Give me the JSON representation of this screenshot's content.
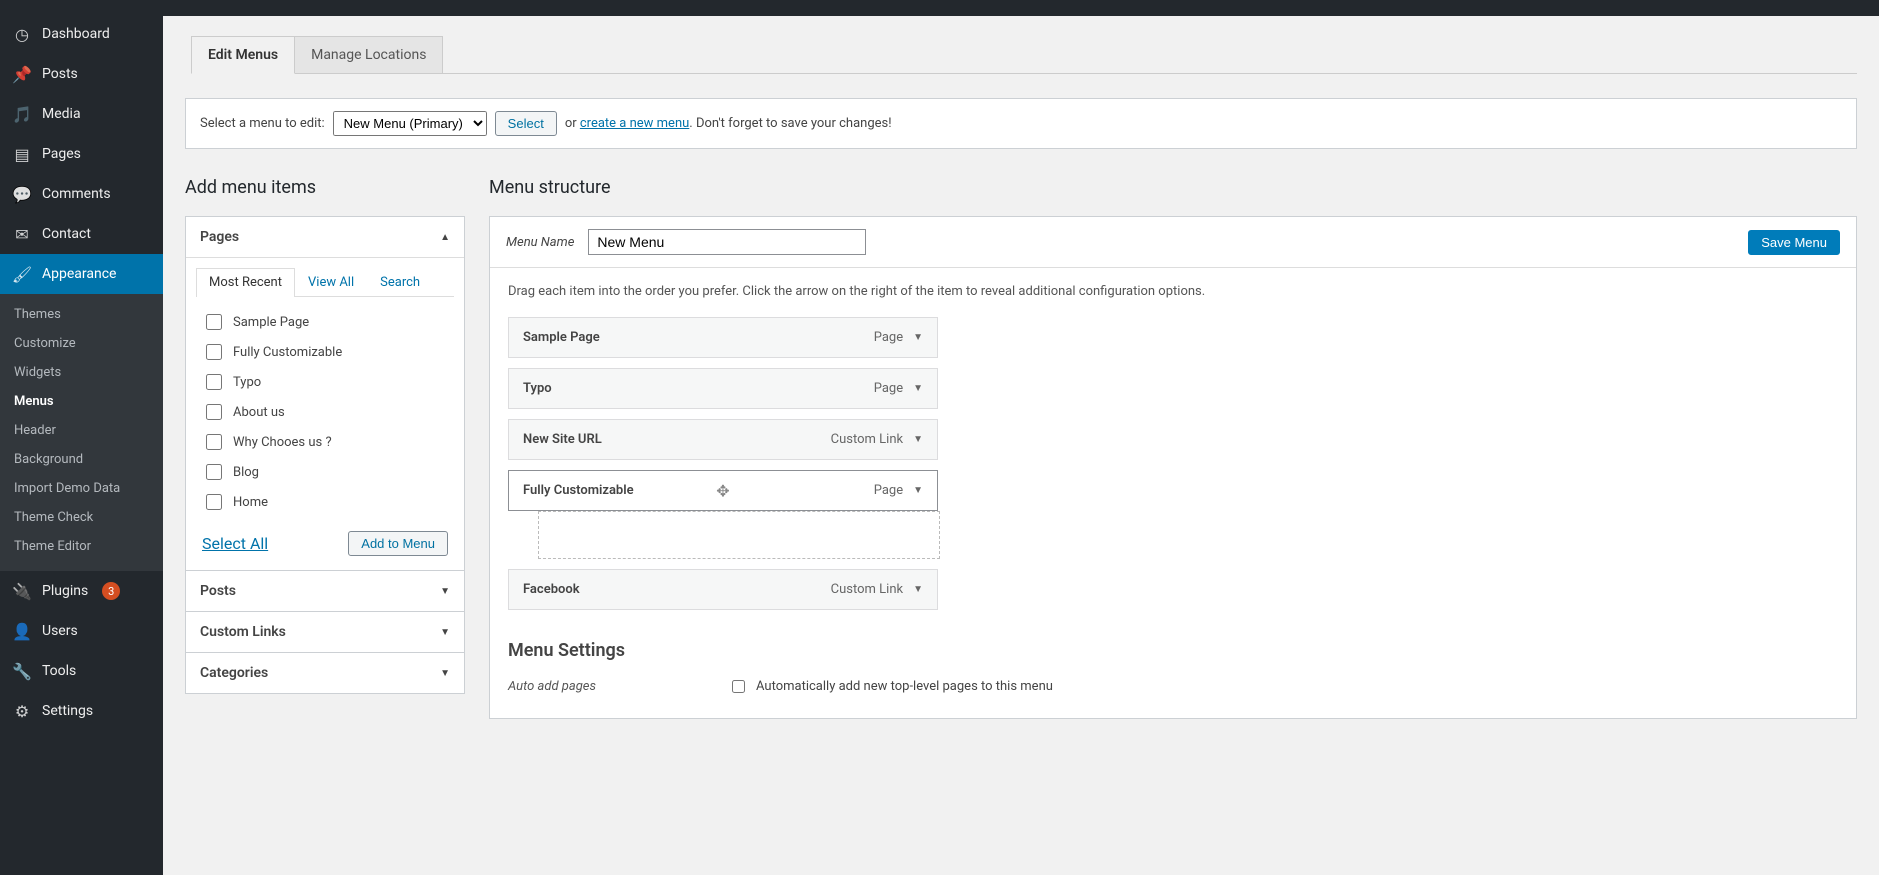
{
  "sidebar": {
    "items": [
      {
        "label": "Dashboard"
      },
      {
        "label": "Posts"
      },
      {
        "label": "Media"
      },
      {
        "label": "Pages"
      },
      {
        "label": "Comments"
      },
      {
        "label": "Contact"
      },
      {
        "label": "Appearance"
      },
      {
        "label": "Plugins"
      },
      {
        "label": "Users"
      },
      {
        "label": "Tools"
      },
      {
        "label": "Settings"
      }
    ],
    "plugins_badge": "3",
    "appearance_sub": [
      {
        "label": "Themes"
      },
      {
        "label": "Customize"
      },
      {
        "label": "Widgets"
      },
      {
        "label": "Menus"
      },
      {
        "label": "Header"
      },
      {
        "label": "Background"
      },
      {
        "label": "Import Demo Data"
      },
      {
        "label": "Theme Check"
      },
      {
        "label": "Theme Editor"
      }
    ]
  },
  "tabs": {
    "edit": "Edit Menus",
    "locations": "Manage Locations"
  },
  "picker": {
    "label": "Select a menu to edit:",
    "selected": "New Menu (Primary)",
    "select_btn": "Select",
    "or": "or ",
    "create": "create a new menu",
    "after": ". Don't forget to save your changes!"
  },
  "left": {
    "heading": "Add menu items",
    "pages_heading": "Pages",
    "subtabs": {
      "recent": "Most Recent",
      "viewall": "View All",
      "search": "Search"
    },
    "pages": [
      {
        "label": "Sample Page"
      },
      {
        "label": "Fully Customizable"
      },
      {
        "label": "Typo"
      },
      {
        "label": "About us"
      },
      {
        "label": "Why Chooes us ?"
      },
      {
        "label": "Blog"
      },
      {
        "label": "Home"
      }
    ],
    "select_all": "Select All",
    "add_btn": "Add to Menu",
    "posts": "Posts",
    "custom_links": "Custom Links",
    "categories": "Categories"
  },
  "right": {
    "heading": "Menu structure",
    "menu_name_lbl": "Menu Name",
    "menu_name": "New Menu",
    "save": "Save Menu",
    "instr": "Drag each item into the order you prefer. Click the arrow on the right of the item to reveal additional configuration options.",
    "items": [
      {
        "title": "Sample Page",
        "type": "Page"
      },
      {
        "title": "Typo",
        "type": "Page"
      },
      {
        "title": "New Site URL",
        "type": "Custom Link"
      },
      {
        "title": "Fully Customizable",
        "type": "Page"
      },
      {
        "title": "Facebook",
        "type": "Custom Link"
      }
    ],
    "settings_heading": "Menu Settings",
    "auto_lbl": "Auto add pages",
    "auto_cb": "Automatically add new top-level pages to this menu"
  }
}
